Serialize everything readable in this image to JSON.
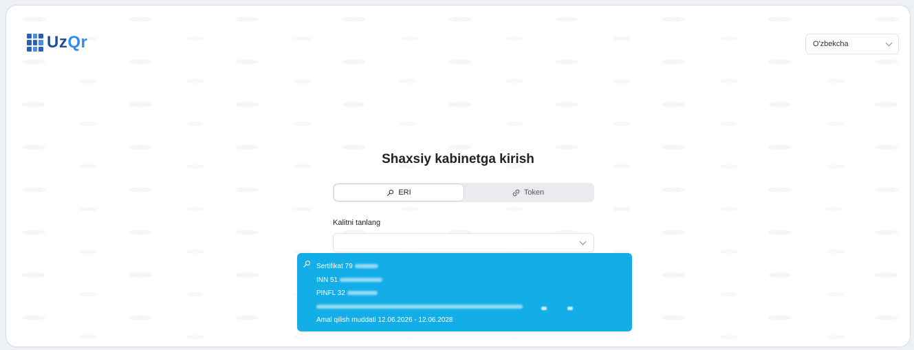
{
  "header": {
    "logo_text_uz": "Uz",
    "logo_text_qr": "Qr",
    "language_select": {
      "value": "O'zbekcha"
    }
  },
  "login": {
    "title": "Shaxsiy kabinetga kirish",
    "tabs": [
      {
        "label": "ERI",
        "icon": "key-icon",
        "active": true
      },
      {
        "label": "Token",
        "icon": "link-icon",
        "active": false
      }
    ],
    "key_select_label": "Kalitni tanlang",
    "key_select_value": ""
  },
  "dropdown": {
    "options": [
      {
        "certificate": "Sertifikat 79",
        "inn": "INN 51",
        "pinfl": "PINFL 32",
        "name": "",
        "validity": "Amal qilish muddati 12.06.2026 - 12.06.2028",
        "highlighted": true
      }
    ]
  },
  "colors": {
    "brand_dark": "#1f4e9c",
    "brand_light": "#2f8cf0",
    "highlight": "#13aee8"
  }
}
